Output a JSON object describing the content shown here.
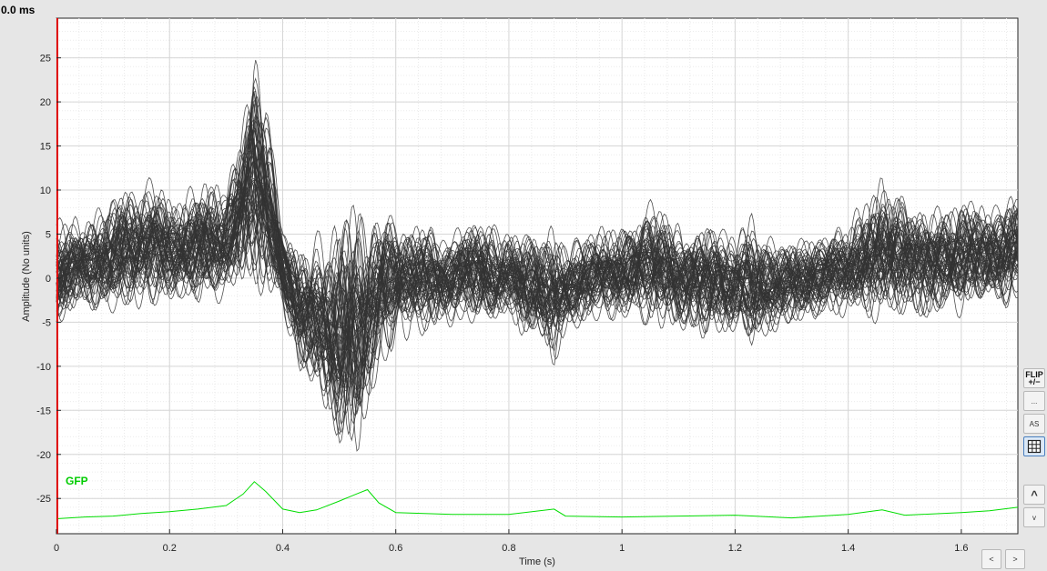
{
  "readout": {
    "time": "0.0 ms"
  },
  "chart_data": {
    "type": "line",
    "title": "",
    "xlabel": "Time (s)",
    "ylabel": "Amplitude (No units)",
    "xlim": [
      0,
      1.7
    ],
    "ylim": [
      -29,
      29.5
    ],
    "grid": true,
    "x_ticks": [
      0,
      0.2,
      0.4,
      0.6,
      0.8,
      1,
      1.2,
      1.4,
      1.6
    ],
    "x_tick_labels": [
      "0",
      "0.2",
      "0.4",
      "0.6",
      "0.8",
      "1",
      "1.2",
      "1.4",
      "1.6"
    ],
    "y_ticks": [
      25,
      20,
      15,
      10,
      5,
      0,
      -5,
      -10,
      -15,
      -20,
      -25
    ],
    "y_tick_labels": [
      "25",
      "20",
      "15",
      "10",
      "5",
      "0",
      "-5",
      "-10",
      "-15",
      "-20",
      "-25"
    ],
    "cursor_time": 0,
    "colors": {
      "channels": "#333333",
      "gfp": "#00dd00",
      "cursor": "#e00000"
    },
    "envelope": {
      "x": [
        0,
        0.05,
        0.1,
        0.15,
        0.2,
        0.25,
        0.3,
        0.33,
        0.35,
        0.37,
        0.4,
        0.43,
        0.46,
        0.5,
        0.53,
        0.56,
        0.6,
        0.65,
        0.7,
        0.75,
        0.8,
        0.85,
        0.88,
        0.9,
        0.95,
        1,
        1.05,
        1.1,
        1.15,
        1.2,
        1.23,
        1.25,
        1.3,
        1.35,
        1.4,
        1.46,
        1.5,
        1.55,
        1.6,
        1.65,
        1.7
      ],
      "upper": [
        7,
        8,
        10,
        12,
        11,
        11,
        12,
        20,
        27,
        22,
        8,
        4,
        6,
        9,
        10,
        9,
        8,
        7,
        6,
        8,
        6,
        6,
        7,
        5,
        6,
        7,
        9,
        8,
        7,
        6,
        8,
        6,
        5,
        6,
        7,
        12,
        10,
        9,
        10,
        9,
        11
      ],
      "lower": [
        -6,
        -5,
        -5,
        -4,
        -4,
        -4,
        -4,
        -3,
        -3,
        -4,
        -5,
        -12,
        -14,
        -24,
        -23,
        -13,
        -8,
        -7,
        -6,
        -6,
        -6,
        -8,
        -12,
        -7,
        -6,
        -5,
        -6,
        -7,
        -8,
        -7,
        -10,
        -8,
        -6,
        -5,
        -5,
        -6,
        -5,
        -5,
        -5,
        -4,
        -4
      ]
    },
    "series": [
      {
        "name": "GFP",
        "x": [
          0,
          0.05,
          0.1,
          0.15,
          0.2,
          0.25,
          0.3,
          0.33,
          0.35,
          0.37,
          0.4,
          0.43,
          0.46,
          0.5,
          0.53,
          0.55,
          0.57,
          0.6,
          0.7,
          0.8,
          0.88,
          0.9,
          1,
          1.1,
          1.2,
          1.3,
          1.4,
          1.46,
          1.5,
          1.6,
          1.65,
          1.7
        ],
        "values": [
          -27.3,
          -27.1,
          -27,
          -26.7,
          -26.5,
          -26.2,
          -25.8,
          -24.5,
          -23.1,
          -24.2,
          -26.2,
          -26.6,
          -26.3,
          -25.3,
          -24.5,
          -24.0,
          -25.5,
          -26.6,
          -26.8,
          -26.8,
          -26.2,
          -27,
          -27.1,
          -27,
          -26.9,
          -27.2,
          -26.8,
          -26.3,
          -26.9,
          -26.6,
          -26.4,
          -26
        ]
      }
    ]
  },
  "buttons": {
    "flip_label": "FLIP",
    "flip_sub": "+/−",
    "dots_label": "...",
    "as_label": "AS",
    "up_label": "^",
    "down_label": "v",
    "left_label": "<",
    "right_label": ">"
  },
  "icons": {
    "grid": "grid-icon"
  }
}
